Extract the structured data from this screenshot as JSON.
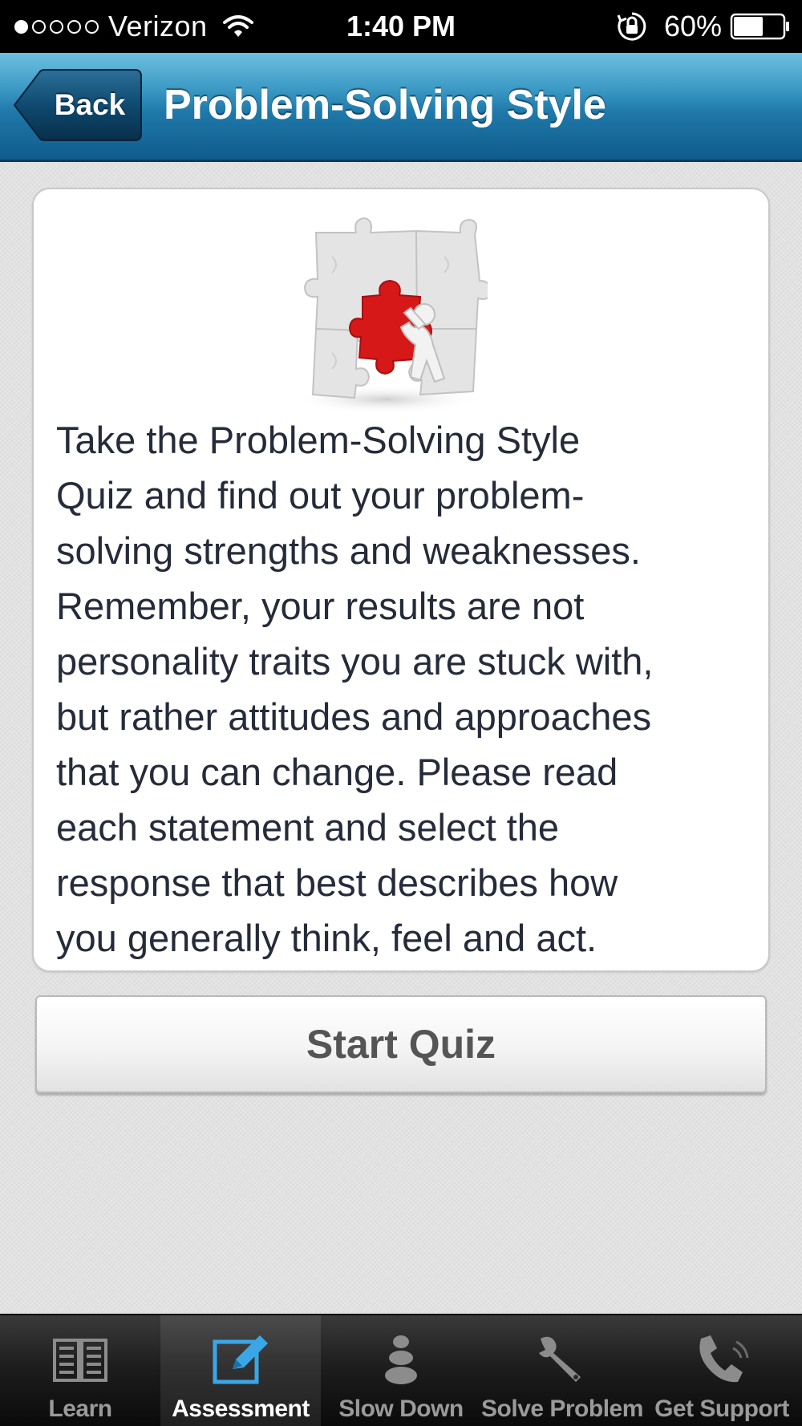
{
  "status_bar": {
    "carrier": "Verizon",
    "signal_strength_dots": 1,
    "signal_total_dots": 5,
    "time": "1:40 PM",
    "battery_percent": "60%",
    "battery_level": 0.6,
    "icons": [
      "wifi-icon",
      "orientation-lock-icon",
      "battery-icon"
    ]
  },
  "nav": {
    "back_label": "Back",
    "title": "Problem-Solving Style"
  },
  "card": {
    "image": "puzzle-figure-image",
    "intro_text": "Take the Problem-Solving Style Quiz and find out your problem-solving strengths and weaknesses. Remember, your results are not personality traits you are stuck with, but rather attitudes and approaches that you can change. Please read each statement and select the response that best describes how you generally think, feel and act.",
    "intro_lines": [
      "Take the Problem-Solving Style",
      "Quiz and find out your problem-",
      "solving strengths and weaknesses.",
      "Remember, your results are not",
      "personality traits you are stuck with,",
      "but rather attitudes and approaches",
      "that you can change. Please read",
      "each statement and select the",
      "response that best describes how",
      "you generally think, feel and act."
    ]
  },
  "actions": {
    "start_label": "Start Quiz"
  },
  "tab_bar": {
    "active_index": 1,
    "items": [
      {
        "label": "Learn",
        "icon": "book-icon"
      },
      {
        "label": "Assessment",
        "icon": "edit-icon"
      },
      {
        "label": "Slow Down",
        "icon": "stones-icon"
      },
      {
        "label": "Solve Problem",
        "icon": "wrench-icon"
      },
      {
        "label": "Get Support",
        "icon": "phone-icon"
      }
    ]
  },
  "colors": {
    "nav_bar": "#1f79aa",
    "active_tab_icon": "#3ba6e6",
    "text": "#262b3a",
    "puzzle_accent": "#d61818"
  }
}
